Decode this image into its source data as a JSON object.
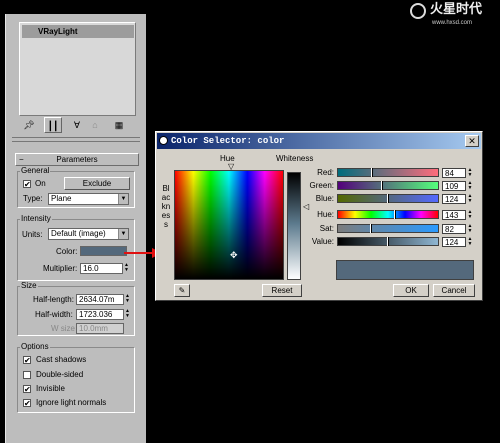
{
  "watermark": {
    "brand": "火星时代",
    "url": "www.hxsd.com"
  },
  "command_panel": {
    "object_name": "VRayLight",
    "toolbar": [
      "pin-icon",
      "stack-icon",
      "fork-icon",
      "trash-icon",
      "configure-icon"
    ],
    "parameters_rollout": "Parameters",
    "general": {
      "title": "General",
      "on_label": "On",
      "on_checked": true,
      "exclude_label": "Exclude",
      "type_label": "Type:",
      "type_value": "Plane"
    },
    "intensity": {
      "title": "Intensity",
      "units_label": "Units:",
      "units_value": "Default (image)",
      "color_label": "Color:",
      "color_value": "#54697c",
      "multiplier_label": "Multiplier:",
      "multiplier_value": "16.0"
    },
    "size": {
      "title": "Size",
      "half_length_label": "Half-length:",
      "half_length_value": "2634.07m",
      "half_width_label": "Half-width:",
      "half_width_value": "1723.036",
      "w_size_label": "W size",
      "w_size_value": "10.0mm"
    },
    "options": {
      "title": "Options",
      "items": [
        {
          "label": "Cast shadows",
          "checked": true
        },
        {
          "label": "Double-sided",
          "checked": false
        },
        {
          "label": "Invisible",
          "checked": true
        },
        {
          "label": "Ignore light normals",
          "checked": true
        }
      ]
    }
  },
  "color_selector": {
    "title": "Color Selector: color",
    "hue_label": "Hue",
    "whiteness_label": "Whiteness",
    "blackness_label": "Blackness",
    "channels": [
      {
        "label": "Red:",
        "value": "84",
        "level": 0.33
      },
      {
        "label": "Green:",
        "value": "109",
        "level": 0.43
      },
      {
        "label": "Blue:",
        "value": "124",
        "level": 0.49
      },
      {
        "label": "Hue:",
        "value": "143",
        "level": 0.56
      },
      {
        "label": "Sat:",
        "value": "82",
        "level": 0.32
      },
      {
        "label": "Value:",
        "value": "124",
        "level": 0.49
      }
    ],
    "preview_color": "#54697c",
    "reset_label": "Reset",
    "ok_label": "OK",
    "cancel_label": "Cancel"
  }
}
